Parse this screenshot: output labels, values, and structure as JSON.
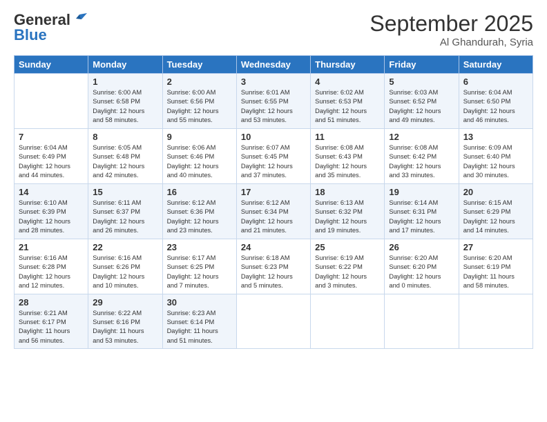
{
  "header": {
    "logo_general": "General",
    "logo_blue": "Blue",
    "month_title": "September 2025",
    "subtitle": "Al Ghandurah, Syria"
  },
  "columns": [
    "Sunday",
    "Monday",
    "Tuesday",
    "Wednesday",
    "Thursday",
    "Friday",
    "Saturday"
  ],
  "weeks": [
    [
      {
        "day": "",
        "info": ""
      },
      {
        "day": "1",
        "info": "Sunrise: 6:00 AM\nSunset: 6:58 PM\nDaylight: 12 hours\nand 58 minutes."
      },
      {
        "day": "2",
        "info": "Sunrise: 6:00 AM\nSunset: 6:56 PM\nDaylight: 12 hours\nand 55 minutes."
      },
      {
        "day": "3",
        "info": "Sunrise: 6:01 AM\nSunset: 6:55 PM\nDaylight: 12 hours\nand 53 minutes."
      },
      {
        "day": "4",
        "info": "Sunrise: 6:02 AM\nSunset: 6:53 PM\nDaylight: 12 hours\nand 51 minutes."
      },
      {
        "day": "5",
        "info": "Sunrise: 6:03 AM\nSunset: 6:52 PM\nDaylight: 12 hours\nand 49 minutes."
      },
      {
        "day": "6",
        "info": "Sunrise: 6:04 AM\nSunset: 6:50 PM\nDaylight: 12 hours\nand 46 minutes."
      }
    ],
    [
      {
        "day": "7",
        "info": "Sunrise: 6:04 AM\nSunset: 6:49 PM\nDaylight: 12 hours\nand 44 minutes."
      },
      {
        "day": "8",
        "info": "Sunrise: 6:05 AM\nSunset: 6:48 PM\nDaylight: 12 hours\nand 42 minutes."
      },
      {
        "day": "9",
        "info": "Sunrise: 6:06 AM\nSunset: 6:46 PM\nDaylight: 12 hours\nand 40 minutes."
      },
      {
        "day": "10",
        "info": "Sunrise: 6:07 AM\nSunset: 6:45 PM\nDaylight: 12 hours\nand 37 minutes."
      },
      {
        "day": "11",
        "info": "Sunrise: 6:08 AM\nSunset: 6:43 PM\nDaylight: 12 hours\nand 35 minutes."
      },
      {
        "day": "12",
        "info": "Sunrise: 6:08 AM\nSunset: 6:42 PM\nDaylight: 12 hours\nand 33 minutes."
      },
      {
        "day": "13",
        "info": "Sunrise: 6:09 AM\nSunset: 6:40 PM\nDaylight: 12 hours\nand 30 minutes."
      }
    ],
    [
      {
        "day": "14",
        "info": "Sunrise: 6:10 AM\nSunset: 6:39 PM\nDaylight: 12 hours\nand 28 minutes."
      },
      {
        "day": "15",
        "info": "Sunrise: 6:11 AM\nSunset: 6:37 PM\nDaylight: 12 hours\nand 26 minutes."
      },
      {
        "day": "16",
        "info": "Sunrise: 6:12 AM\nSunset: 6:36 PM\nDaylight: 12 hours\nand 23 minutes."
      },
      {
        "day": "17",
        "info": "Sunrise: 6:12 AM\nSunset: 6:34 PM\nDaylight: 12 hours\nand 21 minutes."
      },
      {
        "day": "18",
        "info": "Sunrise: 6:13 AM\nSunset: 6:32 PM\nDaylight: 12 hours\nand 19 minutes."
      },
      {
        "day": "19",
        "info": "Sunrise: 6:14 AM\nSunset: 6:31 PM\nDaylight: 12 hours\nand 17 minutes."
      },
      {
        "day": "20",
        "info": "Sunrise: 6:15 AM\nSunset: 6:29 PM\nDaylight: 12 hours\nand 14 minutes."
      }
    ],
    [
      {
        "day": "21",
        "info": "Sunrise: 6:16 AM\nSunset: 6:28 PM\nDaylight: 12 hours\nand 12 minutes."
      },
      {
        "day": "22",
        "info": "Sunrise: 6:16 AM\nSunset: 6:26 PM\nDaylight: 12 hours\nand 10 minutes."
      },
      {
        "day": "23",
        "info": "Sunrise: 6:17 AM\nSunset: 6:25 PM\nDaylight: 12 hours\nand 7 minutes."
      },
      {
        "day": "24",
        "info": "Sunrise: 6:18 AM\nSunset: 6:23 PM\nDaylight: 12 hours\nand 5 minutes."
      },
      {
        "day": "25",
        "info": "Sunrise: 6:19 AM\nSunset: 6:22 PM\nDaylight: 12 hours\nand 3 minutes."
      },
      {
        "day": "26",
        "info": "Sunrise: 6:20 AM\nSunset: 6:20 PM\nDaylight: 12 hours\nand 0 minutes."
      },
      {
        "day": "27",
        "info": "Sunrise: 6:20 AM\nSunset: 6:19 PM\nDaylight: 11 hours\nand 58 minutes."
      }
    ],
    [
      {
        "day": "28",
        "info": "Sunrise: 6:21 AM\nSunset: 6:17 PM\nDaylight: 11 hours\nand 56 minutes."
      },
      {
        "day": "29",
        "info": "Sunrise: 6:22 AM\nSunset: 6:16 PM\nDaylight: 11 hours\nand 53 minutes."
      },
      {
        "day": "30",
        "info": "Sunrise: 6:23 AM\nSunset: 6:14 PM\nDaylight: 11 hours\nand 51 minutes."
      },
      {
        "day": "",
        "info": ""
      },
      {
        "day": "",
        "info": ""
      },
      {
        "day": "",
        "info": ""
      },
      {
        "day": "",
        "info": ""
      }
    ]
  ]
}
